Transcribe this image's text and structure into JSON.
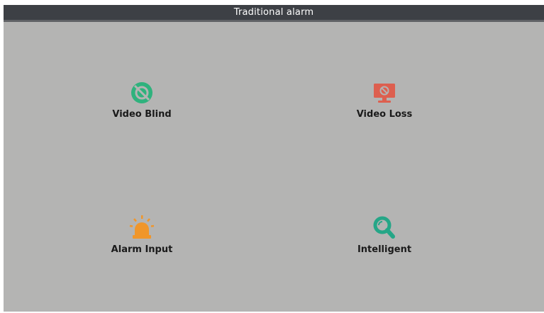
{
  "window": {
    "title": "Traditional alarm"
  },
  "tiles": [
    {
      "id": "video-blind",
      "label": "Video Blind",
      "icon": "video-blind-icon",
      "color": "#2fb27d"
    },
    {
      "id": "video-loss",
      "label": "Video Loss",
      "icon": "video-loss-icon",
      "color": "#dd5f4f"
    },
    {
      "id": "alarm-input",
      "label": "Alarm Input",
      "icon": "alarm-input-icon",
      "color": "#f0962a"
    },
    {
      "id": "intelligent",
      "label": "Intelligent",
      "icon": "intelligent-search-icon",
      "color": "#25a687"
    }
  ],
  "colors": {
    "background": "#b4b4b3",
    "titlebar": "#3d4045",
    "title_text": "#ffffff",
    "label_text": "#1a1a1a"
  }
}
